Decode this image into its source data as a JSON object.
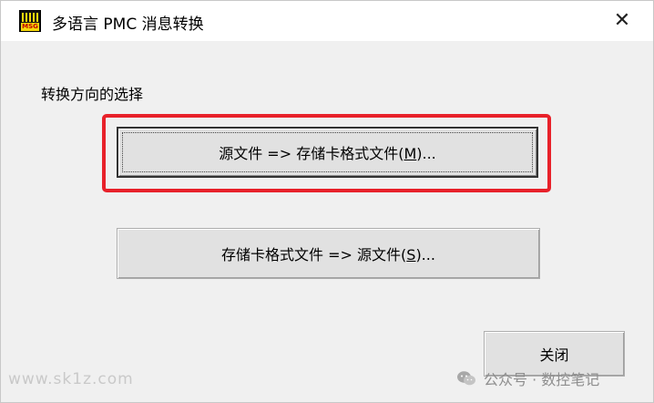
{
  "window": {
    "title": "多语言 PMC 消息转换",
    "icon_text": "MSG",
    "close_glyph": "✕"
  },
  "group": {
    "label": "转换方向的选择"
  },
  "buttons": {
    "src_to_mem": {
      "prefix": "源文件 => 存储卡格式文件(",
      "mnemonic": "M",
      "suffix": ")..."
    },
    "mem_to_src": {
      "prefix": "存储卡格式文件 => 源文件(",
      "mnemonic": "S",
      "suffix": ")..."
    },
    "close_label": "关闭"
  },
  "annotation": {
    "highlight_color": "#e8212a"
  },
  "watermarks": {
    "left": "www.sk1z.com",
    "right": "公众号 · 数控笔记"
  },
  "colors": {
    "button_face": "#e1e1e1",
    "window_bg": "#f0f0f0",
    "titlebar_bg": "#ffffff"
  }
}
